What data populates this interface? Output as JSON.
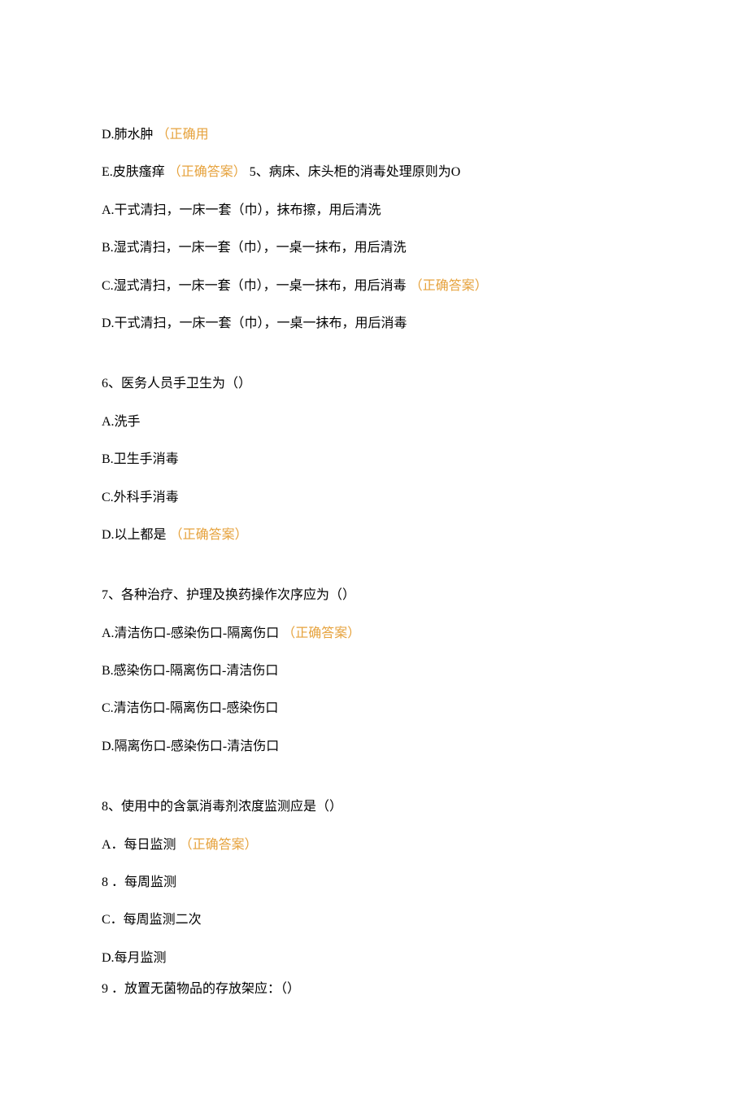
{
  "colors": {
    "text": "#000000",
    "correct": "#e6a23c",
    "background": "#ffffff"
  },
  "lines": {
    "l1_prefix": "D.肺水肿 ",
    "l1_correct": "（正确用",
    "l2_prefix": "E.皮肤瘙痒 ",
    "l2_correct": "（正确答案）",
    "l2_suffix": "  5、病床、床头柜的消毒处理原则为O",
    "l3": "A.干式清扫，一床一套（巾），抹布擦，用后清洗",
    "l4": "B.湿式清扫，一床一套（巾），一桌一抹布，用后清洗",
    "l5_prefix": "C.湿式清扫，一床一套（巾），一桌一抹布，用后消毒 ",
    "l5_correct": "（正确答案）",
    "l6": "D.干式清扫，一床一套（巾），一桌一抹布，用后消毒",
    "q6": "6、医务人员手卫生为（）",
    "q6a": "A.洗手",
    "q6b": "B.卫生手消毒",
    "q6c": "C.外科手消毒",
    "q6d_prefix": "D.以上都是 ",
    "q6d_correct": "（正确答案）",
    "q7": "7、各种治疗、护理及换药操作次序应为（）",
    "q7a_prefix": "A.清洁伤口-感染伤口-隔离伤口   ",
    "q7a_correct": "（正确答案）",
    "q7b": "B.感染伤口-隔离伤口-清洁伤口",
    "q7c": "C.清洁伤口-隔离伤口-感染伤口",
    "q7d": "D.隔离伤口-感染伤口-清洁伤口",
    "q8": "8、使用中的含氯消毒剂浓度监测应是（）",
    "q8a_prefix": "A．每日监测 ",
    "q8a_correct": "（正确答案）",
    "q8b": "8 ．每周监测",
    "q8c": "C．每周监测二次",
    "q8d": "D.每月监测",
    "q9": "9 ．放置无菌物品的存放架应：（）"
  }
}
